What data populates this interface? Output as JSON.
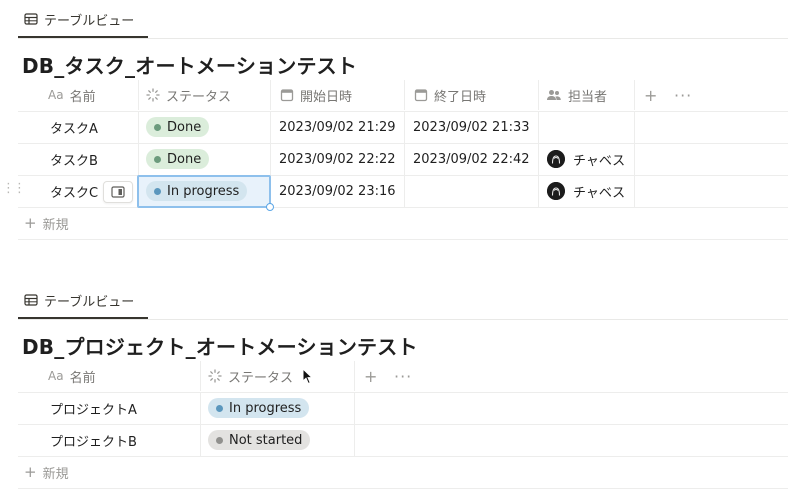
{
  "db1": {
    "view_tab_label": "テーブルビュー",
    "title": "DB_タスク_オートメーションテスト",
    "headers": {
      "name": "名前",
      "name_prefix": "Aa",
      "status": "ステータス",
      "start": "開始日時",
      "end": "終了日時",
      "assignee": "担当者"
    },
    "rows": [
      {
        "name": "タスクA",
        "status": "Done",
        "start": "2023/09/02 21:29",
        "end": "2023/09/02 21:33",
        "assignee": ""
      },
      {
        "name": "タスクB",
        "status": "Done",
        "start": "2023/09/02 22:22",
        "end": "2023/09/02 22:42",
        "assignee": "チャベス"
      },
      {
        "name": "タスクC",
        "status": "In progress",
        "start": "2023/09/02 23:16",
        "end": "",
        "assignee": "チャベス"
      }
    ],
    "new_label": "新規",
    "add_icon": "plus-icon",
    "more_icon": "more-horizontal-icon"
  },
  "db2": {
    "view_tab_label": "テーブルビュー",
    "title": "DB_プロジェクト_オートメーションテスト",
    "headers": {
      "name": "名前",
      "name_prefix": "Aa",
      "status": "ステータス"
    },
    "rows": [
      {
        "name": "プロジェクトA",
        "status": "In progress"
      },
      {
        "name": "プロジェクトB",
        "status": "Not started"
      }
    ],
    "new_label": "新規"
  },
  "colors": {
    "done_bg": "#dbeddb",
    "in_progress_bg": "#d3e5ef",
    "not_started_bg": "#e3e2e0",
    "selection": "#8ec0ec"
  }
}
